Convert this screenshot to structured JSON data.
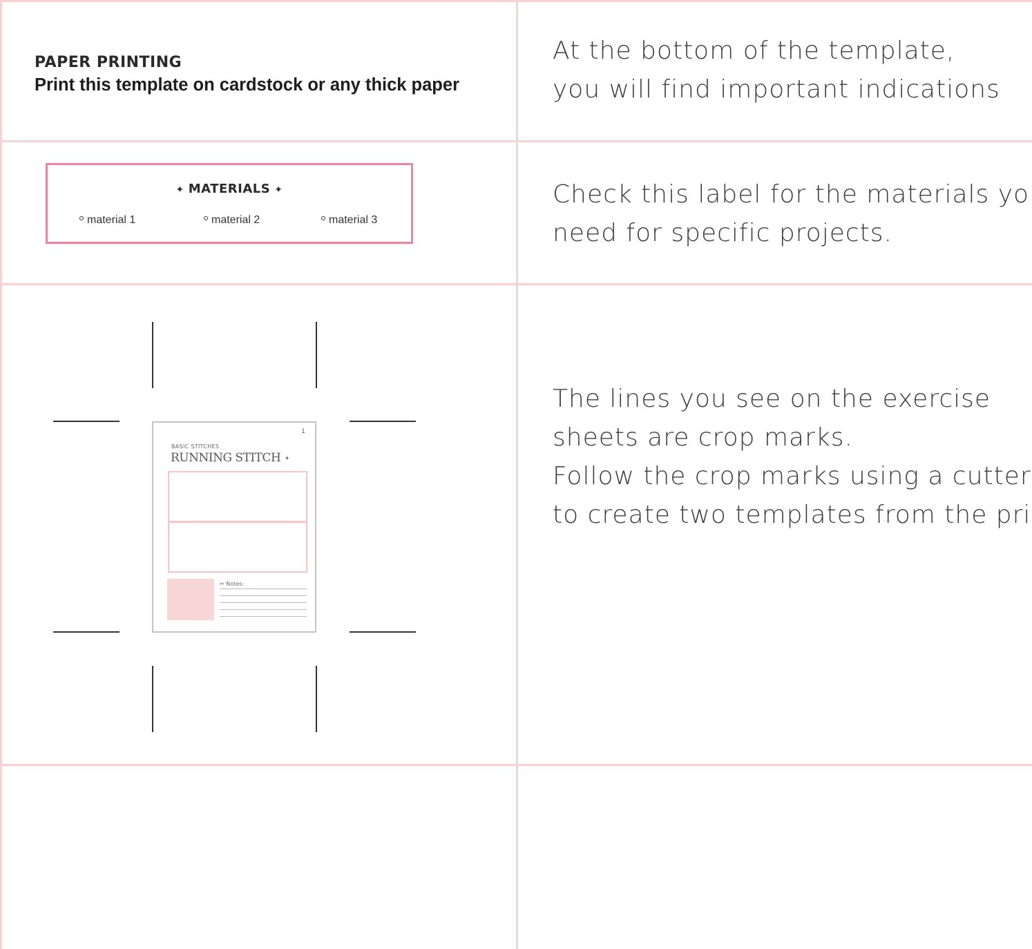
{
  "header": {
    "title": "PAPER PRINTING",
    "subtitle": "Print this template on cardstock or any thick paper"
  },
  "instructions": {
    "bottom_indications": [
      "At the bottom of the template,",
      "you will find important indications"
    ],
    "materials_label": [
      "Check this label for the materials you'll",
      "need for specific projects."
    ],
    "crop_marks": [
      "The lines you see on the exercise",
      "sheets are crop marks.",
      "Follow the crop marks using a cutter",
      "to create two templates from the print."
    ]
  },
  "materials_label": {
    "title": "MATERIALS",
    "items": [
      "material 1",
      "material 2",
      "material 3"
    ]
  },
  "template_preview": {
    "page_number": "1",
    "category": "BASIC STITCHES",
    "title": "RUNNING STITCH",
    "notes_label": "Notes:"
  },
  "colors": {
    "accent_pink": "#e28aa0",
    "grid_pink": "#f6d3d3",
    "swatch_pink": "#f8d6d6"
  }
}
